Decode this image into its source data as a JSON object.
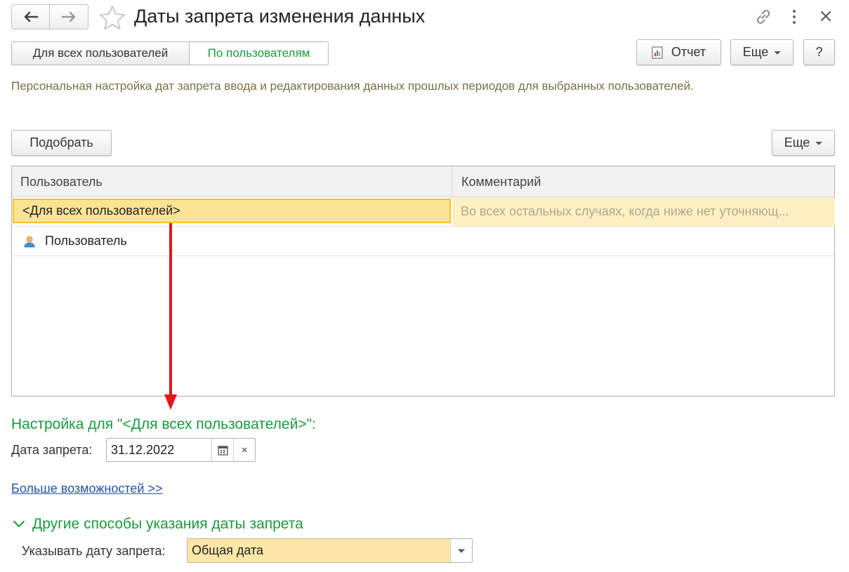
{
  "window": {
    "title": "Даты запрета изменения данных",
    "icons": {
      "back": "arrow-left-icon",
      "forward": "arrow-right-icon",
      "favorite": "star-icon",
      "link": "link-icon",
      "more": "vertical-dots-icon",
      "close": "close-icon"
    }
  },
  "tabs": {
    "all_users": "Для всех пользователей",
    "by_users": "По пользователям"
  },
  "toolbar": {
    "report_label": "Отчет",
    "more_label": "Еще",
    "help_label": "?"
  },
  "hint": "Персональная настройка дат запрета ввода и редактирования данных прошлых периодов для выбранных пользователей.",
  "list_toolbar": {
    "pick_label": "Подобрать",
    "more_label": "Еще"
  },
  "table": {
    "columns": [
      "Пользователь",
      "Комментарий"
    ],
    "rows": [
      {
        "user": "<Для всех пользователей>",
        "comment": "Во всех остальных случаях, когда ниже нет уточняющ..."
      },
      {
        "user": "Пользователь",
        "comment": ""
      }
    ]
  },
  "settings": {
    "heading": "Настройка для \"<Для всех пользователей>\":",
    "date_label": "Дата запрета:",
    "date_value": "31.12.2022",
    "more_link": "Больше возможностей >>"
  },
  "other": {
    "heading": "Другие способы указания даты запрета",
    "label": "Указывать дату запрета:",
    "value": "Общая дата"
  },
  "colors": {
    "accent_green": "#1a9b3c",
    "selection": "#fbe494",
    "arrow": "#e8141a",
    "link": "#2553a8"
  }
}
